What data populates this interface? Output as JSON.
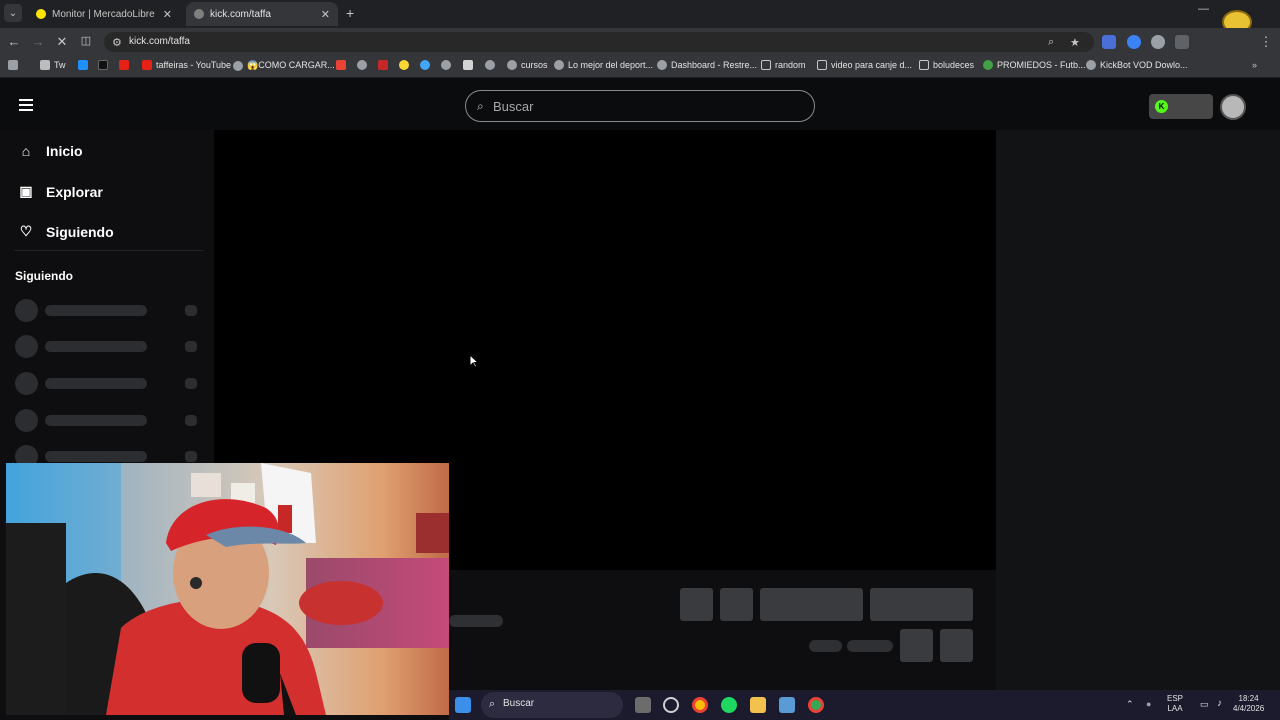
{
  "browser": {
    "tabs": [
      {
        "title": "Monitor | MercadoLibre",
        "active": false
      },
      {
        "title": "kick.com/taffa",
        "active": true
      }
    ],
    "new_tab": "+",
    "url": "kick.com/taffa",
    "bookmarks": [
      {
        "label": "Tw"
      },
      {
        "label": "taffeiras - YouTube"
      },
      {
        "label": "😱COMO CARGAR..."
      },
      {
        "label": "cursos"
      },
      {
        "label": "Lo mejor del deport..."
      },
      {
        "label": "Dashboard - Restre..."
      },
      {
        "label": "random"
      },
      {
        "label": "video para canje d..."
      },
      {
        "label": "boludeces"
      },
      {
        "label": "PROMIEDOS - Futb..."
      },
      {
        "label": "KickBot VOD Dowlo..."
      }
    ]
  },
  "kick": {
    "search_placeholder": "Buscar",
    "nav": [
      {
        "label": "Inicio",
        "icon": "home-icon"
      },
      {
        "label": "Explorar",
        "icon": "explore-icon"
      },
      {
        "label": "Siguiendo",
        "icon": "heart-icon"
      }
    ],
    "following_heading": "Siguiendo",
    "kick_badge": "K",
    "accent_color": "#53fc18"
  },
  "taskbar": {
    "search_label": "Buscar",
    "lang_top": "ESP",
    "lang_bottom": "LAA",
    "time": "18:24",
    "date": "4/4/2026"
  }
}
